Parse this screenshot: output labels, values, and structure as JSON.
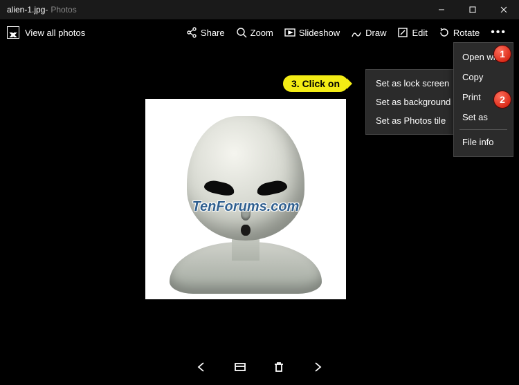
{
  "titlebar": {
    "filename": "alien-1.jpg",
    "separator": " - ",
    "appname": "Photos"
  },
  "toolbar": {
    "view_all": "View all photos",
    "share": "Share",
    "zoom": "Zoom",
    "slideshow": "Slideshow",
    "draw": "Draw",
    "edit": "Edit",
    "rotate": "Rotate"
  },
  "watermark": "TenForums.com",
  "submenu": {
    "lock_screen": "Set as lock screen",
    "background": "Set as background",
    "photos_tile": "Set as Photos tile"
  },
  "mainmenu": {
    "open_with": "Open with",
    "copy": "Copy",
    "print": "Print",
    "set_as": "Set as",
    "file_info": "File info"
  },
  "callout": "3. Click on",
  "steps": {
    "one": "1",
    "two": "2"
  }
}
